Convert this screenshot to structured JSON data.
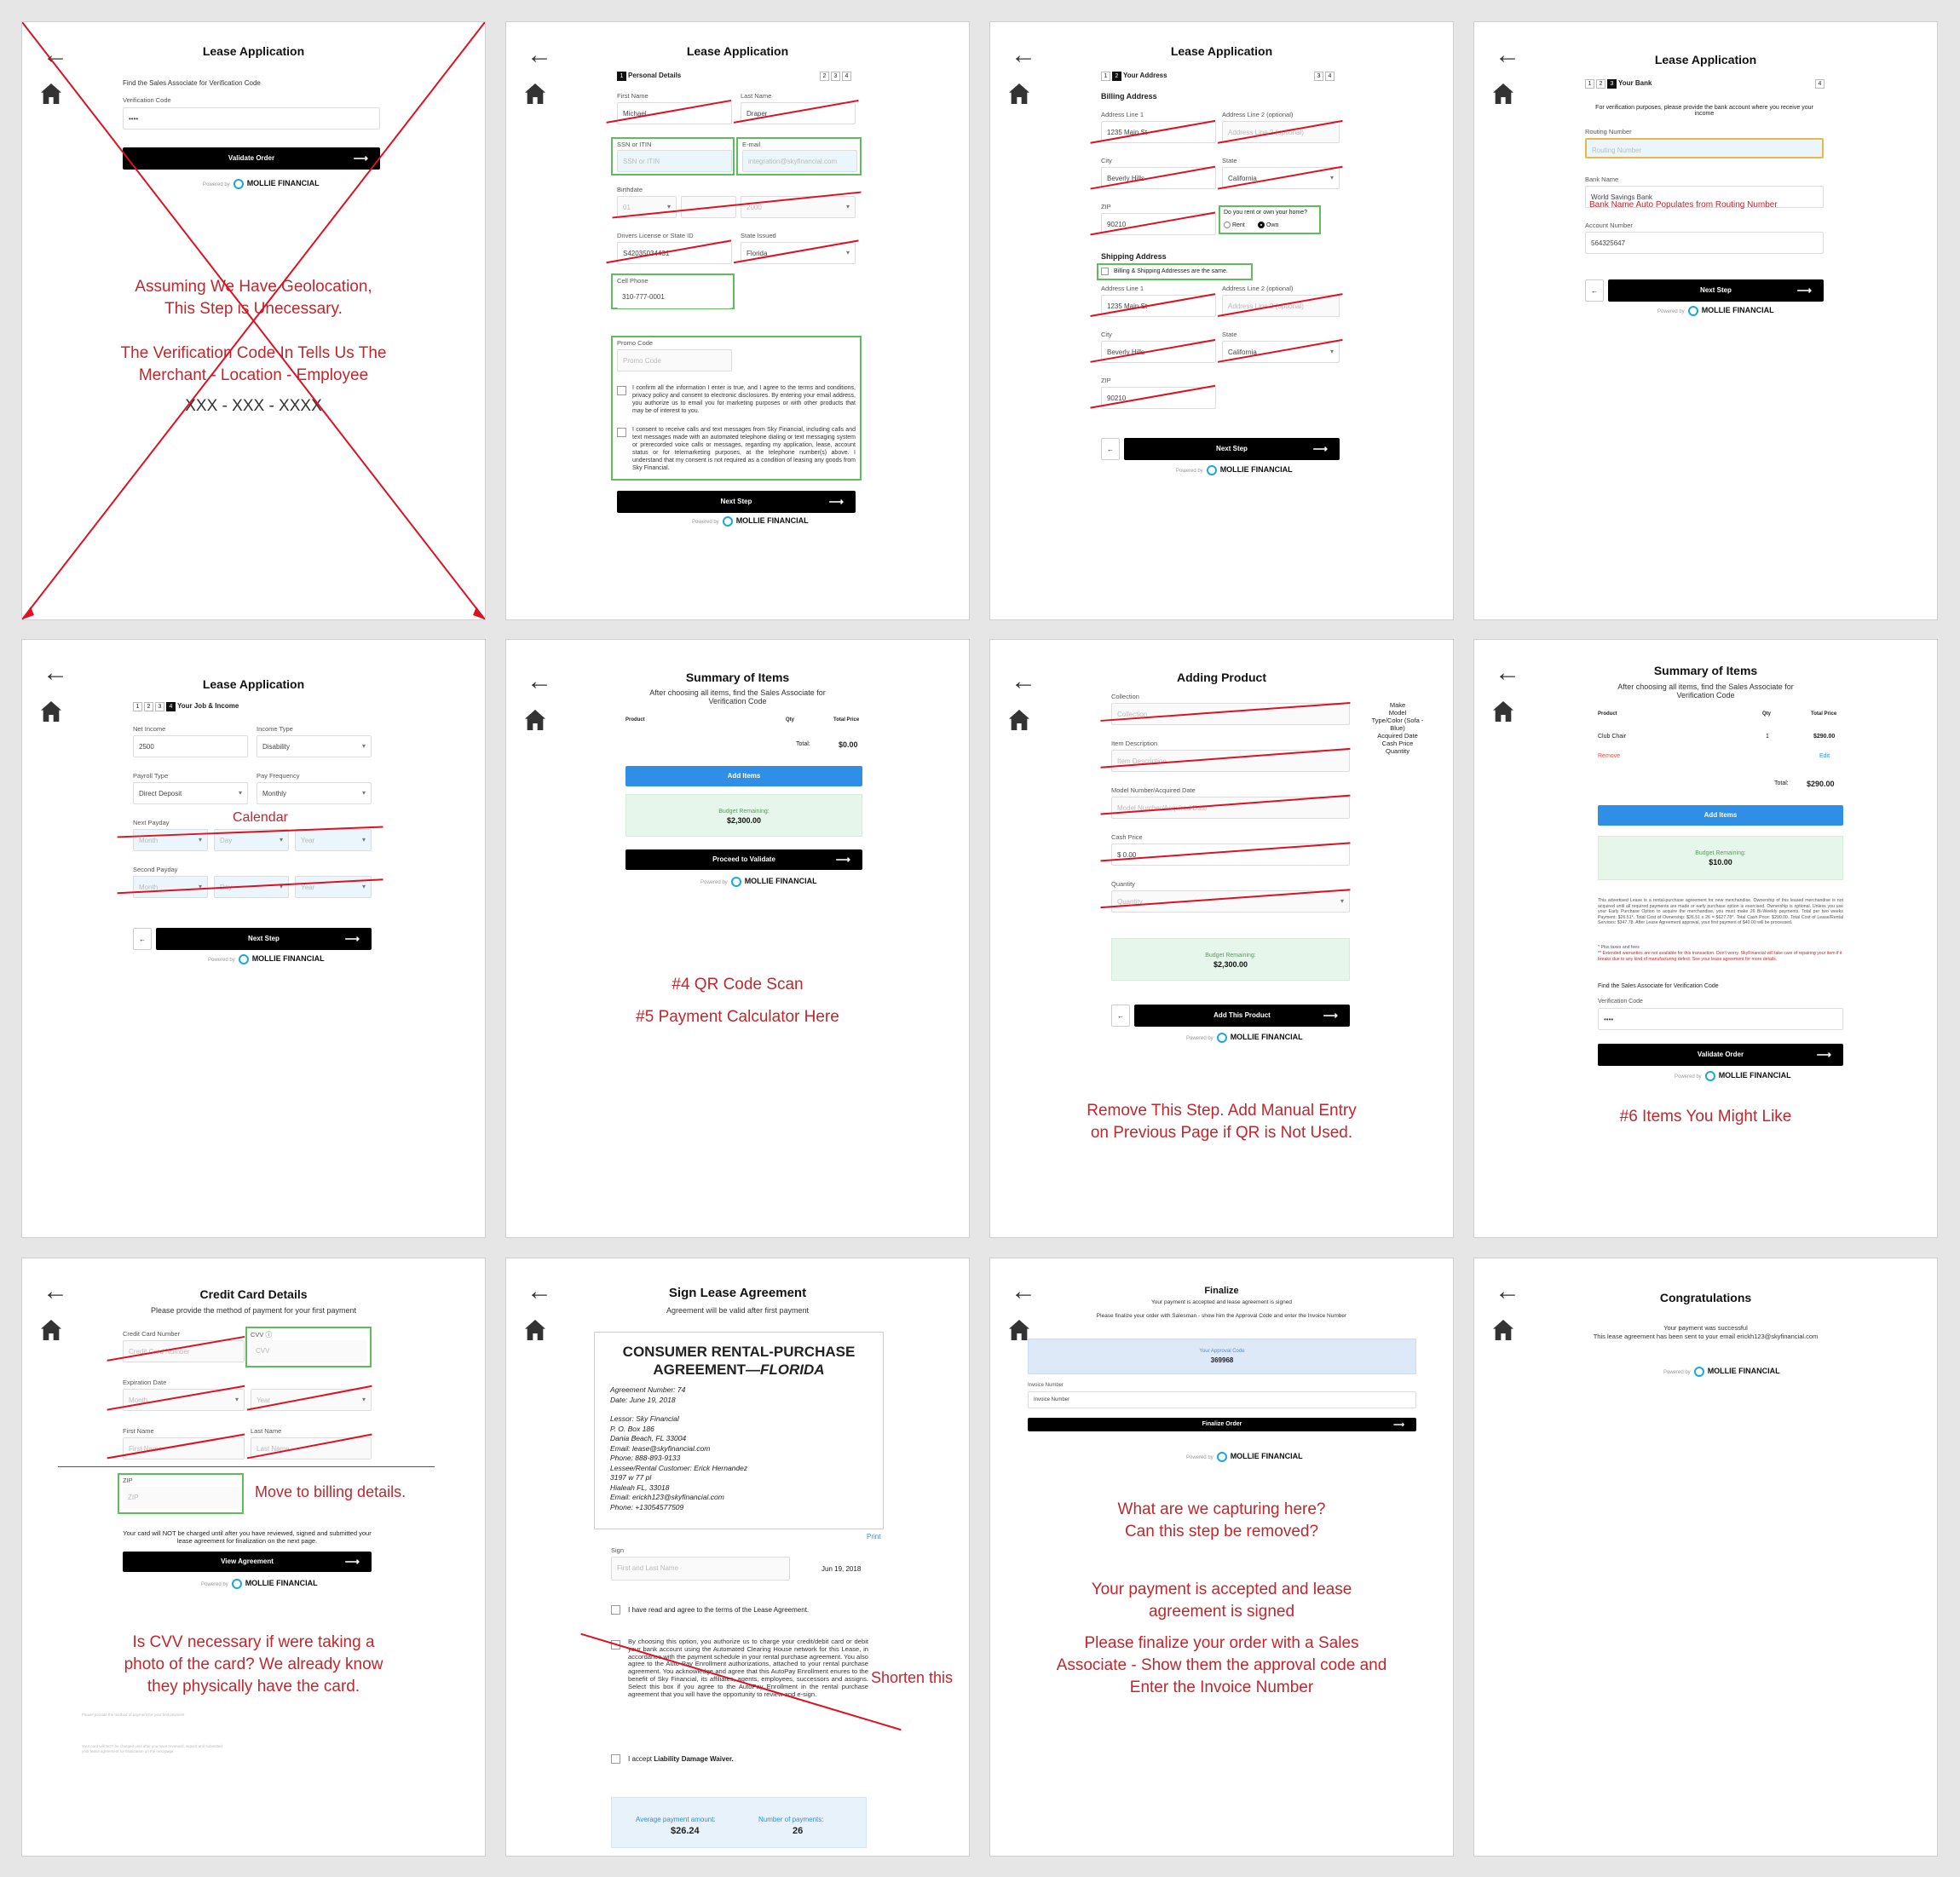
{
  "colors": {
    "accent_red": "#c1272d",
    "primary_black": "#000000",
    "button_blue": "#2f8ee6",
    "highlight_green": "#5cbf5c",
    "budget_green": "#e7f6ea"
  },
  "common": {
    "lease_title": "Lease Application",
    "powered_by": "Powered by",
    "brand": "MOLLIE FINANCIAL",
    "next_step": "Next Step",
    "back_icon": "arrow-left-icon",
    "home_icon": "home-icon"
  },
  "p1": {
    "find_text": "Find the Sales Associate for Verification Code",
    "verification_label": "Verification Code",
    "verification_value": "••••",
    "validate_button": "Validate Order",
    "note1": "Assuming We Have Geolocation,",
    "note2": "This Step is Unecessary.",
    "note3": "The Verification Code In Tells Us The",
    "note4": "Merchant - Location - Employee",
    "note5": "XXX - XXX - XXXX"
  },
  "p2": {
    "step_label": "Personal Details",
    "first_name_label": "First Name",
    "first_name": "Michael",
    "last_name_label": "Last Name",
    "last_name": "Draper",
    "ssn_label": "SSN or ITIN",
    "ssn_placeholder": "SSN or ITIN",
    "email_label": "E-mail",
    "email_placeholder": "integration@skyfinancial.com",
    "birthdate_label": "Birthdate",
    "birth_day": "01",
    "birth_year": "2000",
    "license_label": "Drivers License or State ID",
    "license_value": "S42035034431",
    "state_issued_label": "State Issued",
    "state_issued": "Florida",
    "cell_label": "Cell Phone",
    "cell_value": "310-777-0001",
    "promo_label": "Promo Code",
    "promo_placeholder": "Promo Code",
    "consent1": "I confirm all the information I enter is true, and I agree to the terms and conditions, privacy policy and consent to electronic disclosures. By entering your email address, you authorize us to email you for marketing purposes or with other products that may be of interest to you.",
    "consent2": "I consent to receive calls and text messages from Sky Financial, including calls and text messages made with an automated telephone dialing or text messaging system or prerecorded voice calls or messages, regarding my application, lease, account status or for telemarketing purposes, at the telephone number(s) above. I understand that my consent is not required as a condition of leasing any goods from Sky Financial."
  },
  "p3": {
    "step_label": "Your Address",
    "billing_heading": "Billing Address",
    "addr1_label": "Address Line 1",
    "addr1": "1235 Main St",
    "addr2_label": "Address Line 2 (optional)",
    "addr2_placeholder": "Address Line 2 (optional)",
    "city_label": "City",
    "city": "Beverly Hills",
    "state_label": "State",
    "state": "California",
    "zip_label": "ZIP",
    "zip": "90210",
    "rent_question": "Do you rent or own your home?",
    "rent": "Rent",
    "own": "Own",
    "shipping_heading": "Shipping Address",
    "same_label": "Billing & Shipping Addresses are the same."
  },
  "p4": {
    "step_label": "Your Bank",
    "intro": "For verification purposes, please provide the bank account where you receive your income",
    "routing_label": "Routing Number",
    "routing_placeholder": "Routing Number",
    "bank_label": "Bank Name",
    "bank_value": "World Savings Bank",
    "bank_note": "Bank Name Auto Populates from Routing Number",
    "account_label": "Account Number",
    "account_value": "564325647"
  },
  "p5": {
    "step_label": "Your Job & Income",
    "net_label": "Net Income",
    "net_value": "2500",
    "income_type_label": "Income Type",
    "income_type": "Disability",
    "payroll_label": "Payroll Type",
    "payroll": "Direct Deposit",
    "freq_label": "Pay Frequency",
    "freq": "Monthly",
    "next_payday_label": "Next Payday",
    "second_payday_label": "Second Payday",
    "month": "Month",
    "day": "Day",
    "year": "Year",
    "calendar_note": "Calendar"
  },
  "p6": {
    "title": "Summary of Items",
    "sub": "After choosing all items, find the Sales Associate for Verification Code",
    "col_product": "Product",
    "col_qty": "Qty",
    "col_total": "Total Price",
    "total_label": "Total:",
    "total_value": "$0.00",
    "add_items": "Add Items",
    "budget_label": "Budget Remaining:",
    "budget_value": "$2,300.00",
    "proceed": "Proceed to Validate",
    "note1": "#4 QR Code Scan",
    "note2": "#5 Payment Calculator Here"
  },
  "p7": {
    "title": "Adding Product",
    "collection_label": "Collection",
    "collection_placeholder": "Collection",
    "desc_label": "Item Description",
    "desc_placeholder": "Item Description",
    "model_label": "Model Number/Acquired Date",
    "model_placeholder": "Model Number/Acquired Date",
    "price_label": "Cash Price",
    "price_value": "$ 0.00",
    "qty_label": "Quantity",
    "qty_placeholder": "Quantity",
    "side_list": [
      "Make",
      "Model",
      "Type/Color (Sofa - Blue)",
      "Acquired Date",
      "Cash Price",
      "Quantity"
    ],
    "budget_label": "Budget Remaining:",
    "budget_value": "$2,300.00",
    "add_product": "Add This Product",
    "note1": "Remove This Step. Add Manual Entry",
    "note2": "on Previous Page if QR is Not Used."
  },
  "p8": {
    "title": "Summary of Items",
    "sub": "After choosing all items, find the Sales Associate for Verification Code",
    "col_product": "Product",
    "col_qty": "Qty",
    "col_total": "Total Price",
    "item_name": "Club Chair",
    "item_qty": "1",
    "item_price": "$290.00",
    "remove": "Remove",
    "edit": "Edit",
    "total_label": "Total:",
    "total_value": "$290.00",
    "add_items": "Add Items",
    "budget_label": "Budget Remaining:",
    "budget_value": "$10.00",
    "disclosure": "This advertised Lease is a rental-purchase agreement for new merchandise. Ownership of this leased merchandise is not acquired until all required payments are made or early purchase option is exercised. Ownership is optional. Unless you use your Early Purchase Option to acquire the merchandise, you must make 26 Bi-Weekly payments. Total per two weeks Payment: $26.51*. Total Cost of Ownership: $26.51 x 26 = $627.78*. Total Cash Price: $290.00. Total Cost of Lease/Rental Services: $347.78. After Lease Agreement approval, your first payment of $40.00 will be processed.",
    "plus_taxes": "* Plus taxes and fees",
    "warranty": "** Extended warranties are not available for this transaction. Don't worry. SkyFinancial will take care of repairing your item if it breaks due to any kind of manufacturing defect. See your lease agreement for more details.",
    "find_text": "Find the Sales Associate for Verification Code",
    "verification_label": "Verification Code",
    "verification_value": "••••",
    "validate": "Validate Order",
    "note1": "#6 Items You Might Like"
  },
  "p9": {
    "title": "Credit Card Details",
    "sub": "Please provide the method of payment for your first payment",
    "cc_label": "Credit Card Number",
    "cc_placeholder": "Credit Card Number",
    "cvv_label": "CVV",
    "cvv_placeholder": "CVV",
    "exp_label": "Expiration Date",
    "month": "Month",
    "year": "Year",
    "first_label": "First Name",
    "first_placeholder": "First Name",
    "last_label": "Last Name",
    "last_placeholder": "Last Name",
    "zip_label": "ZIP",
    "zip_placeholder": "ZIP",
    "move_note": "Move to billing details.",
    "charge_note": "Your card will NOT be charged until after you have reviewed, signed and submitted your lease agreement for finalization on the next page.",
    "view": "View Agreement",
    "note1": "Is CVV necessary if were taking a",
    "note2": "photo of the card? We already know",
    "note3": "they physically have the card.",
    "faint1": "Please provide the method of payment for your first payment",
    "faint2": "Your card will NOT be charged until after you have reviewed, signed and submitted your lease agreement for finalization on the next page."
  },
  "p10": {
    "title": "Sign Lease Agreement",
    "sub": "Agreement will be valid after first payment",
    "doc_title1": "CONSUMER RENTAL-PURCHASE",
    "doc_title2": "AGREEMENT—",
    "doc_title3": "FLORIDA",
    "doc_lines": [
      "Agreement Number: 74",
      "Date: June 19, 2018",
      "",
      "Lessor: Sky Financial",
      "P. O. Box 186",
      "Dania Beach, FL 33004",
      "Email: lease@skyfinancial.com",
      "Phone: 888-893-9133",
      "Lessee/Rental Customer: Erick Hernandez",
      "3197 w 77 pl",
      "Hialeah FL, 33018",
      "Email: erickh123@skyfinancial.com",
      "Phone: +13054577509"
    ],
    "print": "Print",
    "sign_label": "Sign",
    "sign_placeholder": "First and Last Name",
    "sign_date": "Jun 19, 2018",
    "agree": "I have read and agree to the terms of the Lease Agreement.",
    "autopay": "By choosing this option, you authorize us to charge your credit/debit card or debit your bank account using the Automated Clearing House network for this Lease, in accordance with the payment schedule in your rental purchase agreement. You also agree to the Auto Pay Enrollment authorizations, attached to your rental purchase agreement. You acknowledge and agree that this AutoPay Enrollment enures to the benefit of Sky Financial, its affiliates, agents, employees, successors and assigns. Select this box if you agree to the AutoPay Enrollment in the rental purchase agreement that you will have the opportunity to review and e-sign.",
    "shorten": "Shorten this",
    "ldw_prefix": "I accept ",
    "ldw": "Liability Damage Waiver.",
    "avg_label": "Average payment amount:",
    "avg_value": "$26.24",
    "num_label": "Number of payments:",
    "num_value": "26"
  },
  "p11": {
    "title": "Finalize",
    "sub1": "Your payment is accepted and lease agreement is signed",
    "sub2": "Please finalize your order with Salesman - show him the Approval Code and enter the Invoice Number",
    "approval_label": "Your Approval Code",
    "approval_value": "369968",
    "invoice_label": "Invoice Number",
    "invoice_placeholder": "Invoice Number",
    "finalize": "Finalize Order",
    "note1": "What are we capturing here?",
    "note2": "Can this step be removed?",
    "note3": "Your payment is accepted and lease",
    "note4": "agreement is signed",
    "note5": "Please finalize your order with a Sales",
    "note6": "Associate - Show them the approval code and",
    "note7": "Enter the Invoice Number"
  },
  "p12": {
    "title": "Congratulations",
    "sub1": "Your payment was successful",
    "sub2": "This lease agreement has been sent to your email erickh123@skyfinancial.com"
  }
}
